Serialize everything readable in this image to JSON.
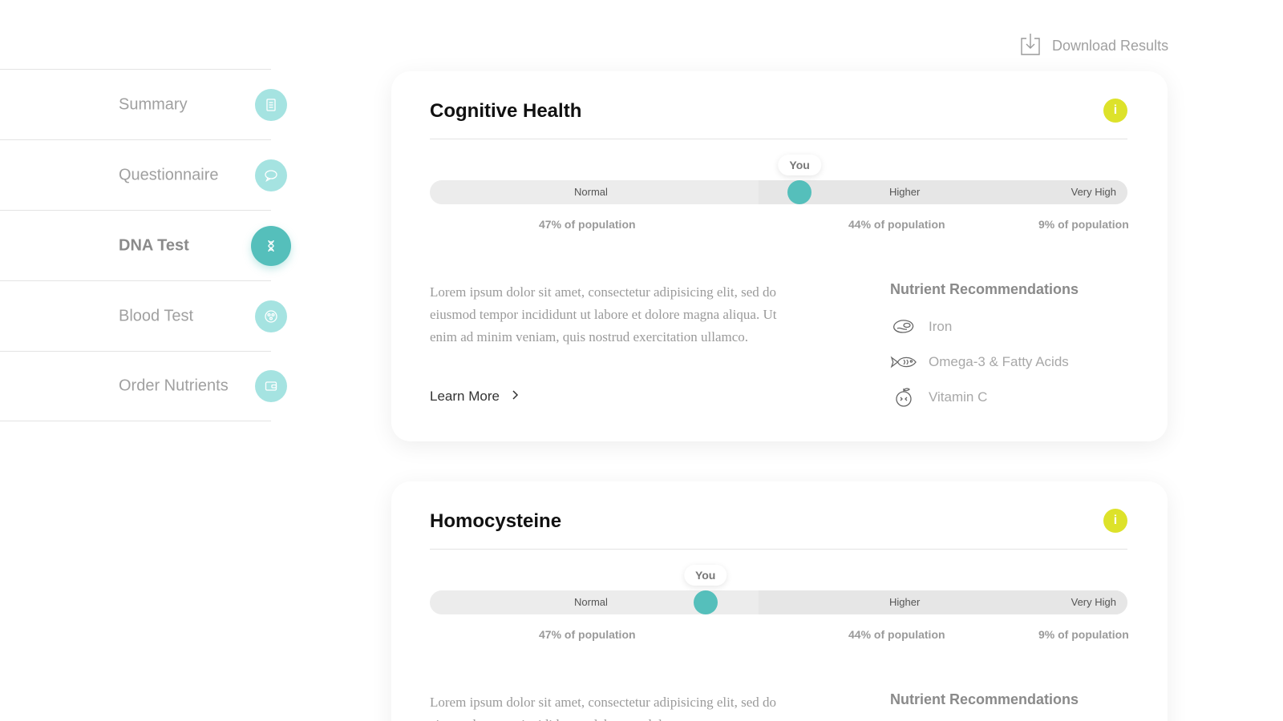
{
  "sidebar": {
    "items": [
      {
        "label": "Summary",
        "icon": "document-icon",
        "active": false
      },
      {
        "label": "Questionnaire",
        "icon": "speech-bubble-icon",
        "active": false
      },
      {
        "label": "DNA Test",
        "icon": "dna-icon",
        "active": true
      },
      {
        "label": "Blood Test",
        "icon": "blood-cell-icon",
        "active": false
      },
      {
        "label": "Order Nutrients",
        "icon": "wallet-icon",
        "active": false
      }
    ]
  },
  "download": {
    "label": "Download Results",
    "icon": "download-icon"
  },
  "colors": {
    "accent": "#55bfbb",
    "accent_light": "#a5e3e1",
    "info": "#dde22a"
  },
  "cards": [
    {
      "title": "Cognitive Health",
      "info_label": "i",
      "scale": {
        "labels": [
          "Normal",
          "Higher",
          "Very High"
        ],
        "you_label": "You",
        "you_position": 0.53,
        "populations": [
          "47% of population",
          "44% of population",
          "9% of population"
        ]
      },
      "description": "Lorem ipsum dolor sit amet, consectetur adipisicing elit, sed do eiusmod tempor incididunt ut labore et dolore magna aliqua. Ut enim ad minim veniam, quis nostrud exercitation ullamco.",
      "learn_more": "Learn More",
      "nutrients_title": "Nutrient Recommendations",
      "nutrients": [
        {
          "label": "Iron",
          "icon": "steak-icon"
        },
        {
          "label": "Omega-3 & Fatty Acids",
          "icon": "fish-icon"
        },
        {
          "label": "Vitamin C",
          "icon": "orange-icon"
        }
      ]
    },
    {
      "title": "Homocysteine",
      "info_label": "i",
      "scale": {
        "labels": [
          "Normal",
          "Higher",
          "Very High"
        ],
        "you_label": "You",
        "you_position": 0.395,
        "populations": [
          "47% of population",
          "44% of population",
          "9% of population"
        ]
      },
      "description": "Lorem ipsum dolor sit amet, consectetur adipisicing elit, sed do eiusmod tempor incididunt ut labore et dolore",
      "nutrients_title": "Nutrient Recommendations"
    }
  ]
}
